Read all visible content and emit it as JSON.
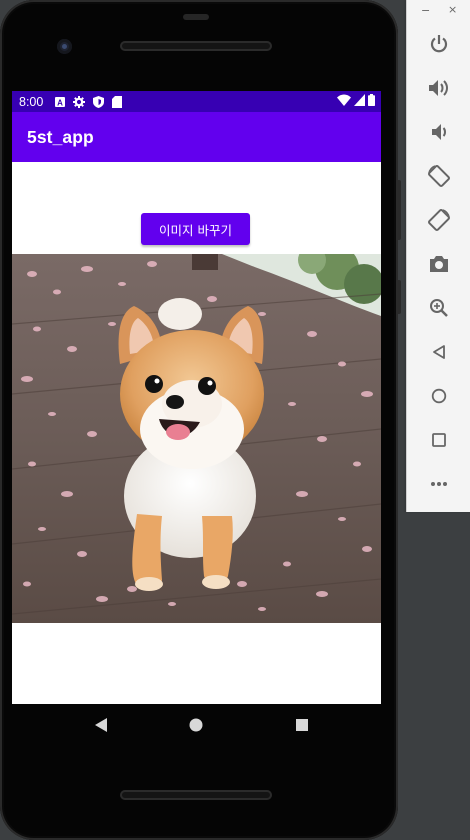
{
  "status_bar": {
    "time": "8:00",
    "left_icons": [
      "notification-a-icon",
      "gear-icon",
      "shield-icon",
      "sd-card-icon"
    ],
    "right_icons": [
      "wifi-icon",
      "cell-signal-icon",
      "battery-icon"
    ]
  },
  "app_bar": {
    "title": "5st_app"
  },
  "main": {
    "change_image_button": "이미지 바꾸기",
    "image": {
      "subject": "pomeranian-dog-photo"
    }
  },
  "nav_bar": {
    "buttons": [
      "back-icon",
      "home-icon",
      "recents-icon"
    ]
  },
  "emulator_toolbar": {
    "window_controls": {
      "minimize": "−",
      "close": "×"
    },
    "buttons": [
      "power-icon",
      "volume-up-icon",
      "volume-down-icon",
      "rotate-left-icon",
      "rotate-right-icon",
      "camera-icon",
      "zoom-icon",
      "back-icon",
      "home-icon",
      "overview-icon",
      "more-icon"
    ]
  },
  "colors": {
    "status_bar": "#3700b3",
    "primary": "#6200ee",
    "screen_background": "#ffffff",
    "icon_gray": "#666666"
  }
}
